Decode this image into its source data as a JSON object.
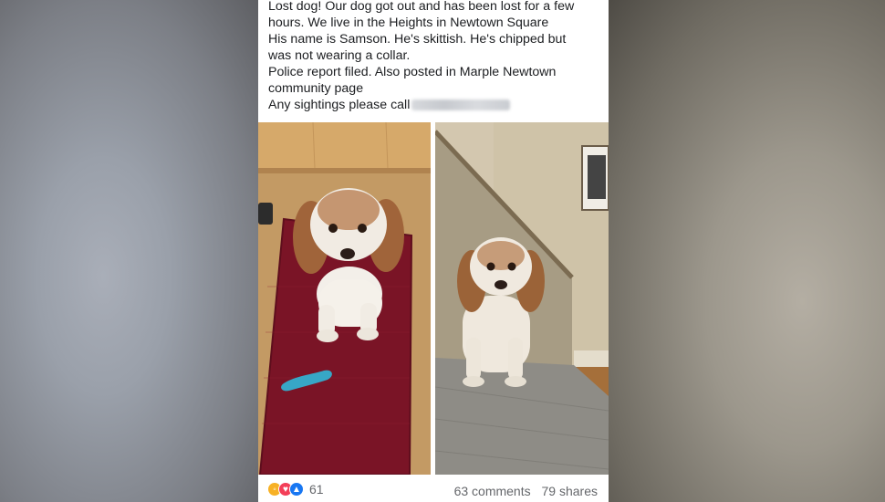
{
  "post": {
    "lines": [
      "Lost dog! Our dog got out and has been lost for a few",
      "hours. We live in the Heights in Newtown Square",
      "His name is Samson. He's skittish. He's chipped but",
      "was not wearing a collar.",
      "Police report filed. Also posted in Marple Newtown",
      "community page",
      "Any sightings please call"
    ]
  },
  "footer": {
    "reaction_icons": [
      "wow-icon",
      "love-icon",
      "like-icon"
    ],
    "reaction_count": "61",
    "comments": "63 comments",
    "shares": "79 shares"
  },
  "colors": {
    "like": "#1877f2",
    "love": "#f33e58",
    "wow": "#f7b125"
  }
}
